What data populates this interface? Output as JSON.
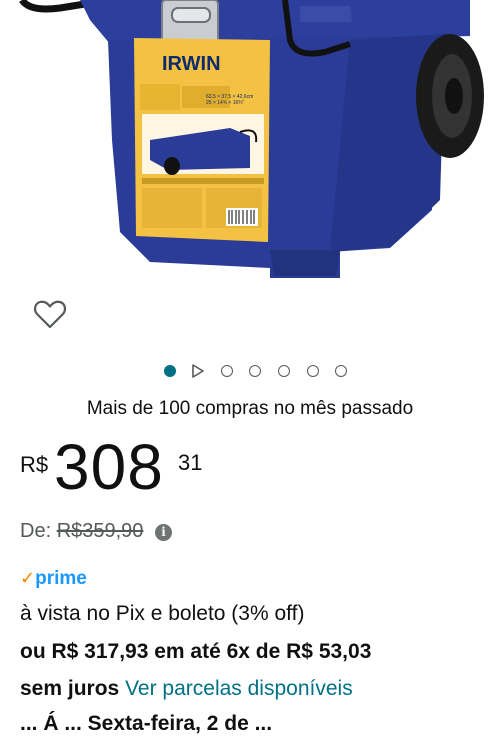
{
  "product": {
    "brand_on_label": "IRWIN",
    "label_dims": "63,5 × 37,5 × 42,6cm",
    "label_dims_in": "25 × 14¾ × 16¾\""
  },
  "carousel": {
    "total_dots": 6,
    "active_index": 0,
    "has_video": true
  },
  "social_proof": {
    "text": "Mais de 100 compras no mês passado"
  },
  "price": {
    "symbol": "R$",
    "whole": "308",
    "fraction": "31"
  },
  "list_price": {
    "label": "De:",
    "value": "R$359,90"
  },
  "prime": {
    "label": "prime"
  },
  "payment": {
    "pix_text": "à vista no Pix e boleto (3% off)",
    "installment_line1": "ou R$ 317,93 em até 6x de R$ 53,03",
    "installment_bold": "sem juros",
    "installment_link": "Ver parcelas disponíveis",
    "cut_line": "... Á ... Sexta-feira, 2 de ..."
  },
  "colors": {
    "accent": "#007185",
    "prime_blue": "#1a98ff",
    "prime_check": "#f08804",
    "box_blue": "#2a3e9a",
    "label_yellow": "#f4c242"
  }
}
